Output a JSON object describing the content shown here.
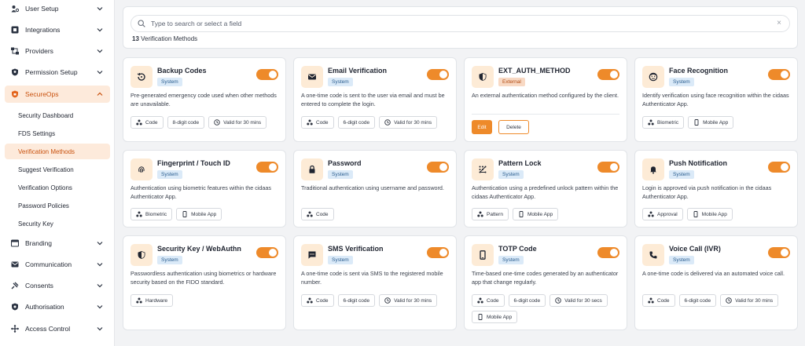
{
  "sidebar": {
    "items": [
      {
        "label": "User Setup",
        "icon": "user-setup-icon"
      },
      {
        "label": "Integrations",
        "icon": "integrations-icon"
      },
      {
        "label": "Providers",
        "icon": "providers-icon"
      },
      {
        "label": "Permission Setup",
        "icon": "permission-icon"
      },
      {
        "label": "SecureOps",
        "icon": "shield-icon",
        "active": true
      },
      {
        "label": "Branding",
        "icon": "branding-icon"
      },
      {
        "label": "Communication",
        "icon": "mail-icon"
      },
      {
        "label": "Consents",
        "icon": "consents-icon"
      },
      {
        "label": "Authorisation",
        "icon": "authorisation-icon"
      },
      {
        "label": "Access Control",
        "icon": "access-control-icon"
      }
    ],
    "subitems": [
      {
        "label": "Security Dashboard"
      },
      {
        "label": "FDS Settings"
      },
      {
        "label": "Verification Methods",
        "active": true
      },
      {
        "label": "Suggest Verification"
      },
      {
        "label": "Verification Options"
      },
      {
        "label": "Password Policies"
      },
      {
        "label": "Security Key"
      }
    ]
  },
  "search": {
    "placeholder": "Type to search or select a field",
    "value": "",
    "count": "13",
    "count_label": "Verification Methods"
  },
  "colors": {
    "accent": "#ee8a2a",
    "active_bg": "#fdeadb",
    "badge_system": "#dbeaf8",
    "badge_external": "#f8d9c4"
  },
  "cards": [
    {
      "title": "Backup Codes",
      "badge": "System",
      "icon": "backup-icon",
      "enabled": true,
      "desc": "Pre-generated emergency code used when other methods are unavailable.",
      "chips": [
        {
          "label": "Code",
          "icon": "code-icon"
        },
        {
          "label": "8-digit code"
        },
        {
          "label": "Valid for 30 mins",
          "icon": "clock-icon"
        }
      ]
    },
    {
      "title": "Email Verification",
      "badge": "System",
      "icon": "mail-icon",
      "enabled": true,
      "desc": "A one-time code is sent to the user via email and must be entered to complete the login.",
      "chips": [
        {
          "label": "Code",
          "icon": "code-icon"
        },
        {
          "label": "6-digit code"
        },
        {
          "label": "Valid for 30 mins",
          "icon": "clock-icon"
        }
      ]
    },
    {
      "title": "EXT_AUTH_METHOD",
      "badge": "External",
      "icon": "shield-icon",
      "enabled": true,
      "desc": "An external authentication method configured by the client.",
      "chips": [],
      "edit_label": "Edit",
      "delete_label": "Delete"
    },
    {
      "title": "Face Recognition",
      "badge": "System",
      "icon": "face-icon",
      "enabled": true,
      "desc": "Identify verification using face recognition within the cidaas Authenticator App.",
      "chips": [
        {
          "label": "Biometric",
          "icon": "code-icon"
        },
        {
          "label": "Mobile App",
          "icon": "mobile-icon"
        }
      ]
    },
    {
      "title": "Fingerprint / Touch ID",
      "badge": "System",
      "icon": "fingerprint-icon",
      "enabled": true,
      "desc": "Authentication using biometric features within the cidaas Authenticator App.",
      "chips": [
        {
          "label": "Biometric",
          "icon": "code-icon"
        },
        {
          "label": "Mobile App",
          "icon": "mobile-icon"
        }
      ]
    },
    {
      "title": "Password",
      "badge": "System",
      "icon": "lock-icon",
      "enabled": true,
      "desc": "Traditional authentication using username and password.",
      "chips": [
        {
          "label": "Code",
          "icon": "code-icon"
        }
      ]
    },
    {
      "title": "Pattern Lock",
      "badge": "System",
      "icon": "pattern-icon",
      "enabled": true,
      "desc": "Authentication using a predefined unlock pattern within the cidaas Authenticator App.",
      "chips": [
        {
          "label": "Pattern",
          "icon": "code-icon"
        },
        {
          "label": "Mobile App",
          "icon": "mobile-icon"
        }
      ]
    },
    {
      "title": "Push Notification",
      "badge": "System",
      "icon": "bell-icon",
      "enabled": true,
      "desc": "Login is approved via push notification in the cidaas Authenticator App.",
      "chips": [
        {
          "label": "Approval",
          "icon": "code-icon"
        },
        {
          "label": "Mobile App",
          "icon": "mobile-icon"
        }
      ]
    },
    {
      "title": "Security Key / WebAuthn",
      "badge": "System",
      "icon": "shield-icon",
      "enabled": true,
      "desc": "Passwordless authentication using biometrics or hardware security based on the FIDO standard.",
      "chips": [
        {
          "label": "Hardware",
          "icon": "code-icon"
        }
      ]
    },
    {
      "title": "SMS Verification",
      "badge": "System",
      "icon": "sms-icon",
      "enabled": true,
      "desc": "A one-time code is sent via SMS to the registered mobile number.",
      "chips": [
        {
          "label": "Code",
          "icon": "code-icon"
        },
        {
          "label": "6-digit code"
        },
        {
          "label": "Valid for 30 mins",
          "icon": "clock-icon"
        }
      ]
    },
    {
      "title": "TOTP Code",
      "badge": "System",
      "icon": "mobile-icon",
      "enabled": true,
      "desc": "Time-based one-time codes generated by an authenticator app that change regularly.",
      "chips": [
        {
          "label": "Code",
          "icon": "code-icon"
        },
        {
          "label": "6-digit code"
        },
        {
          "label": "Valid for 30 secs",
          "icon": "clock-icon"
        },
        {
          "label": "Mobile App",
          "icon": "mobile-icon"
        }
      ]
    },
    {
      "title": "Voice Call (IVR)",
      "badge": "System",
      "icon": "phone-icon",
      "enabled": true,
      "desc": "A one-time code is delivered via an automated voice call.",
      "chips": [
        {
          "label": "Code",
          "icon": "code-icon"
        },
        {
          "label": "6-digit code"
        },
        {
          "label": "Valid for 30 mins",
          "icon": "clock-icon"
        }
      ]
    }
  ]
}
